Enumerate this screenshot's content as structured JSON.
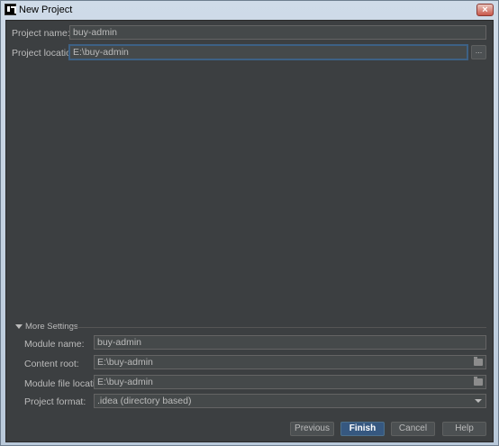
{
  "window": {
    "title": "New Project",
    "close_glyph": "×"
  },
  "form": {
    "project_name_label": "Project name:",
    "project_name_value": "buy-admin",
    "project_location_label": "Project location:",
    "project_location_value": "E:\\buy-admin",
    "browse_label": "..."
  },
  "more_settings": {
    "title": "More Settings",
    "module_name_label": "Module name:",
    "module_name_value": "buy-admin",
    "content_root_label": "Content root:",
    "content_root_value": "E:\\buy-admin",
    "module_file_location_label": "Module file location:",
    "module_file_location_value": "E:\\buy-admin",
    "project_format_label": "Project format:",
    "project_format_value": ".idea (directory based)"
  },
  "buttons": {
    "previous": "Previous",
    "finish": "Finish",
    "cancel": "Cancel",
    "help": "Help"
  },
  "icons": {
    "app": "intellij-icon",
    "folder": "folder-icon",
    "expand": "triangle-down-icon",
    "combo": "chevron-down-icon"
  },
  "colors": {
    "background": "#3c3f41",
    "field": "#45494a",
    "focus": "#3d6185",
    "primary_button": "#365880"
  }
}
